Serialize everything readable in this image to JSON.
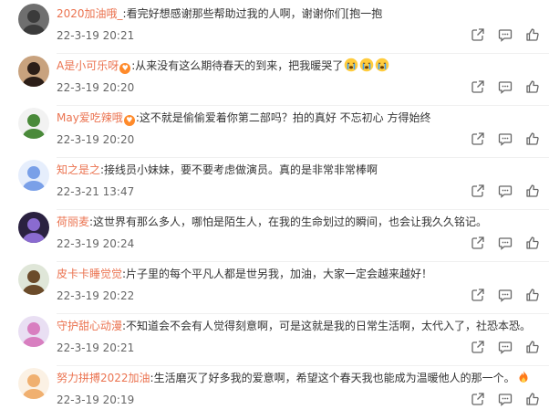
{
  "comments": [
    {
      "user": "2020加油哦_",
      "badge": false,
      "content": ":看完好想感谢那些帮助过我的人啊，谢谢你们[抱一抱",
      "time": "22-3-19 20:21",
      "emojis": 0,
      "avatar": {
        "bg": "#6f6f6f",
        "fg": "#3b3b3b"
      }
    },
    {
      "user": "A是小可乐呀",
      "badge": true,
      "content": ":从来没有这么期待春天的到来，把我暖哭了",
      "time": "22-3-19 20:20",
      "emojis": 3,
      "avatar": {
        "bg": "#c8a27e",
        "fg": "#2c1e18"
      }
    },
    {
      "user": "May爱吃辣哦",
      "badge": true,
      "content": ":这不就是偷偷爱着你第二部吗？拍的真好 不忘初心 方得始终",
      "time": "22-3-19 20:20",
      "emojis": 0,
      "avatar": {
        "bg": "#f2f2f2",
        "fg": "#4a8a3a"
      }
    },
    {
      "user": "知之是之",
      "badge": false,
      "content": ":接线员小妹妹，要不要考虑做演员。真的是非常非常棒啊",
      "time": "22-3-21 13:47",
      "emojis": 0,
      "avatar": {
        "bg": "#e6eefc",
        "fg": "#7aa0e8"
      }
    },
    {
      "user": "荷丽麦",
      "badge": false,
      "content": ":这世界有那么多人，哪怕是陌生人，在我的生命划过的瞬间，也会让我久久铭记。",
      "time": "22-3-19 20:24",
      "emojis": 0,
      "avatar": {
        "bg": "#2a2140",
        "fg": "#8a6bd0"
      }
    },
    {
      "user": "皮卡卡睡觉觉",
      "badge": false,
      "content": ":片子里的每个平凡人都是世另我，加油，大家一定会越来越好！",
      "time": "22-3-19 20:22",
      "emojis": 0,
      "avatar": {
        "bg": "#dfe6d8",
        "fg": "#6b4b2a"
      }
    },
    {
      "user": "守护甜心动漫",
      "badge": false,
      "content": ":不知道会不会有人觉得刻意啊，可是这就是我的日常生活啊，太代入了，社恐本恐。",
      "time": "22-3-19 20:21",
      "emojis": 0,
      "avatar": {
        "bg": "#e9dff3",
        "fg": "#d87fc0"
      }
    },
    {
      "user": "努力拼搏2022加油",
      "badge": false,
      "content": ":生活磨灭了好多我的爱意啊，希望这个春天我也能成为温暖他人的那一个。",
      "time": "22-3-19 20:19",
      "emojis": 1,
      "avatar": {
        "bg": "#fbf1e4",
        "fg": "#f0b070"
      }
    }
  ],
  "icons": {
    "forward": "share-forward-icon",
    "comment": "comment-icon",
    "like": "thumbs-up-icon",
    "badge": "vip-heart-badge-icon",
    "emoji_cry": "crying-face-emoji",
    "emoji_fire": "fire-emoji"
  },
  "colors": {
    "username": "#eb7350",
    "text": "#333333",
    "time": "#666666",
    "icon": "#666666"
  }
}
